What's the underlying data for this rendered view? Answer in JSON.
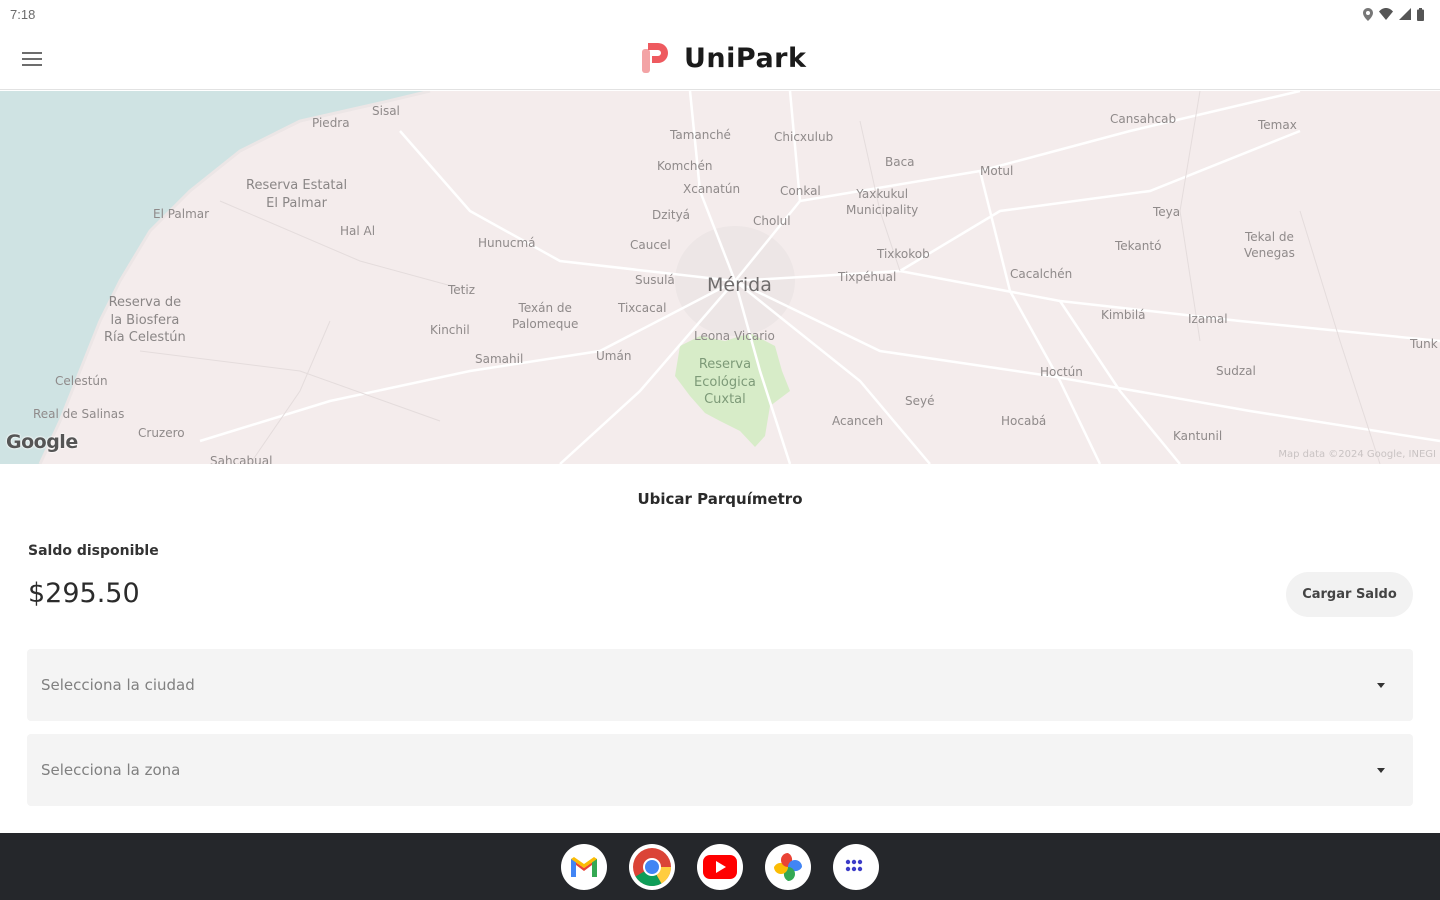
{
  "status_bar": {
    "time": "7:18"
  },
  "app": {
    "title": "UniPark",
    "brand_color": "#ee5a5f"
  },
  "map": {
    "attribution_logo": "Google",
    "attribution_text": "Map data ©2024 Google, INEGI",
    "labels": {
      "sisal": "Sisal",
      "piedra": "Piedra",
      "tamanche": "Tamanché",
      "chicxulub": "Chicxulub",
      "cansahcab": "Cansahcab",
      "temax": "Temax",
      "komchen": "Komchén",
      "baca": "Baca",
      "motul": "Motul",
      "reserva_palmar": "Reserva Estatal\nEl Palmar",
      "xcanatun": "Xcanatún",
      "conkal": "Conkal",
      "yaxkukul": "Yaxkukul\nMunicipality",
      "el_palmar": "El Palmar",
      "dzityá": "Dzityá",
      "cholul": "Cholul",
      "teya": "Teya",
      "hal_al": "Hal Al",
      "hunucma": "Hunucmá",
      "caucel": "Caucel",
      "tekal": "Tekal de\nVenegas",
      "tekanto": "Tekantó",
      "tixkokob": "Tixkokob",
      "susula": "Susulá",
      "merida": "Mérida",
      "cacalchen": "Cacalchén",
      "tixpehual": "Tixpéhual",
      "tetiz": "Tetiz",
      "ria_celestun": "Reserva de\nla Biosfera\nRía Celestún",
      "tixcacal": "Tixcacal",
      "tecoh_palomeque": "Texán de\nPalomeque",
      "kinchil": "Kinchil",
      "dzoyaxche": "Leona Vicario",
      "kimbila": "Kimbilá",
      "izamal": "Izamal",
      "tunkas": "Tunk",
      "samahil": "Samahil",
      "uman": "Umán",
      "reserva_cuxtal": "Reserva\nEcológica\nCuxtal",
      "hoctun": "Hoctún",
      "sudzal": "Sudzal",
      "celestun": "Celestún",
      "seye": "Seyé",
      "real_salinas": "Real de Salinas",
      "acanceh": "Acanceh",
      "hocaba": "Hocabá",
      "cruzero": "Cruzero",
      "kantunil": "Kantunil",
      "sotuta_sisal": "Sahcabual"
    }
  },
  "locate_label": "Ubicar Parquímetro",
  "balance": {
    "label": "Saldo disponible",
    "amount": "$295.50",
    "button": "Cargar Saldo"
  },
  "selects": {
    "city_placeholder": "Selecciona la ciudad",
    "zone_placeholder": "Selecciona la zona"
  },
  "dock": {
    "apps": [
      {
        "name": "Gmail",
        "icon": "gmail-icon"
      },
      {
        "name": "Chrome",
        "icon": "chrome-icon"
      },
      {
        "name": "YouTube",
        "icon": "youtube-icon"
      },
      {
        "name": "Photos",
        "icon": "photos-icon"
      },
      {
        "name": "App launcher",
        "icon": "apps-grid-icon"
      }
    ]
  },
  "colors": {
    "map_land": "#f4ecec",
    "map_water": "#cfe3e3",
    "map_park": "#d7ecc8",
    "taskbar": "#25272b"
  }
}
